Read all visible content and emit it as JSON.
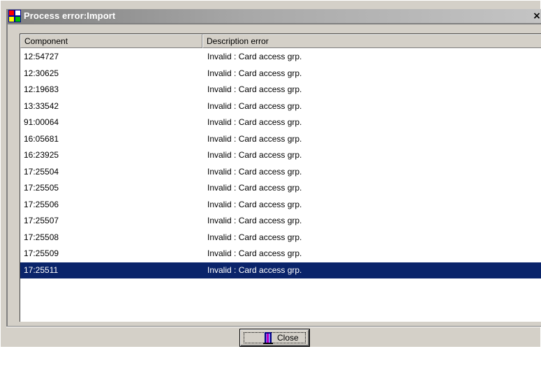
{
  "window": {
    "title": "Process error:Import",
    "close_glyph": "×"
  },
  "grid": {
    "columns": [
      "Component",
      "Description error"
    ],
    "rows": [
      {
        "component": "12:54727",
        "description": "Invalid : Card access grp."
      },
      {
        "component": "12:30625",
        "description": "Invalid : Card access grp."
      },
      {
        "component": "12:19683",
        "description": "Invalid : Card access grp."
      },
      {
        "component": "13:33542",
        "description": "Invalid : Card access grp."
      },
      {
        "component": "91:00064",
        "description": "Invalid : Card access grp."
      },
      {
        "component": "16:05681",
        "description": "Invalid : Card access grp."
      },
      {
        "component": "16:23925",
        "description": "Invalid : Card access grp."
      },
      {
        "component": "17:25504",
        "description": "Invalid : Card access grp."
      },
      {
        "component": "17:25505",
        "description": "Invalid : Card access grp."
      },
      {
        "component": "17:25506",
        "description": "Invalid : Card access grp."
      },
      {
        "component": "17:25507",
        "description": "Invalid : Card access grp."
      },
      {
        "component": "17:25508",
        "description": "Invalid : Card access grp."
      },
      {
        "component": "17:25509",
        "description": "Invalid : Card access grp."
      },
      {
        "component": "17:25511",
        "description": "Invalid : Card access grp.",
        "selected": true
      }
    ]
  },
  "footer": {
    "close_label": "Close",
    "close_icon": "exit-door-icon"
  },
  "colors": {
    "selection": "#0a246a",
    "dialog_face": "#d4d0c8"
  }
}
